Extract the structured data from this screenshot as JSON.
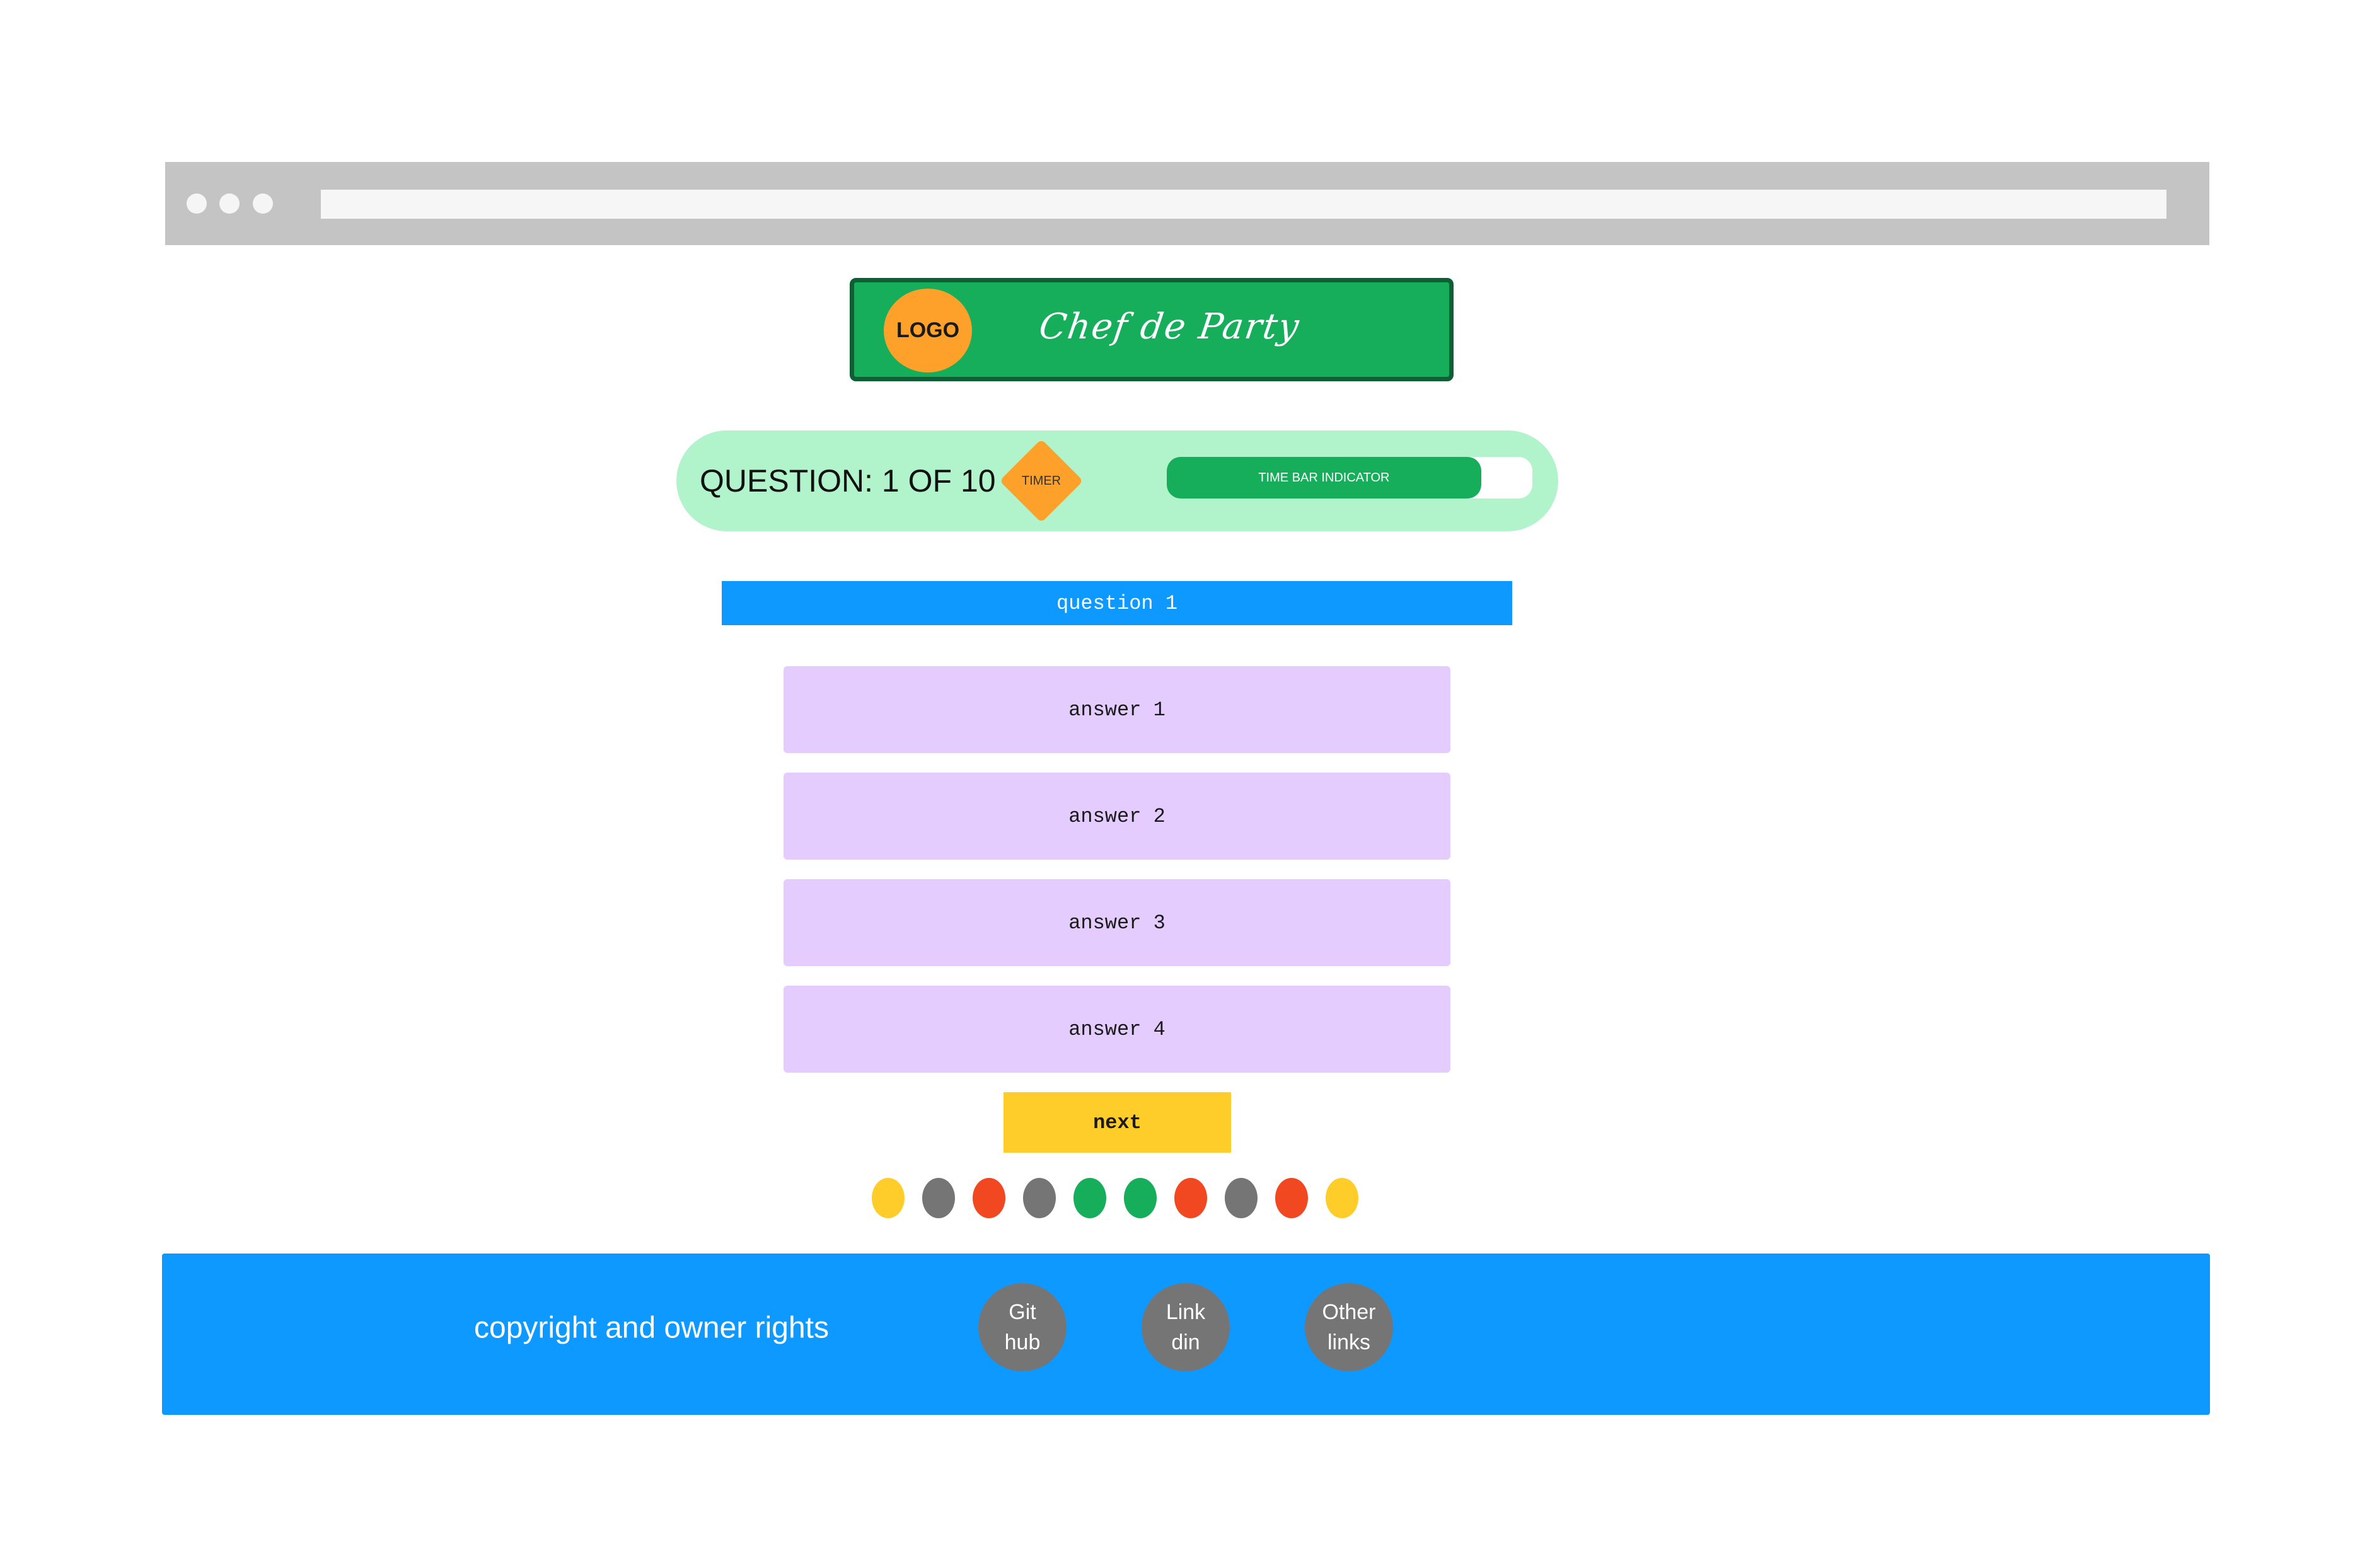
{
  "brand": {
    "logo_label": "LOGO",
    "title": "Chef de Party"
  },
  "status": {
    "question_count": "QUESTION: 1 OF 10",
    "timer_label": "TIMER",
    "time_bar_label": "TIME BAR INDICATOR",
    "time_remaining_fraction": 0.86
  },
  "question": {
    "text": "question 1"
  },
  "answers": [
    {
      "label": "answer 1"
    },
    {
      "label": "answer 2"
    },
    {
      "label": "answer 3"
    },
    {
      "label": "answer 4"
    }
  ],
  "next_label": "next",
  "progress": [
    {
      "color": "#ffcd29"
    },
    {
      "color": "#757575"
    },
    {
      "color": "#f24822"
    },
    {
      "color": "#757575"
    },
    {
      "color": "#16ae5b"
    },
    {
      "color": "#16ae5b"
    },
    {
      "color": "#f24822"
    },
    {
      "color": "#757575"
    },
    {
      "color": "#f24822"
    },
    {
      "color": "#ffcd29"
    }
  ],
  "footer": {
    "copyright": "copyright and owner rights",
    "links": [
      {
        "line1": "Git",
        "line2": "hub"
      },
      {
        "line1": "Link",
        "line2": "din"
      },
      {
        "line1": "Other",
        "line2": "links"
      }
    ]
  },
  "colors": {
    "accent_blue": "#0d99ff",
    "brand_green": "#16ae5b",
    "status_bg": "#b1f4cb",
    "answer_bg": "#e4ccff",
    "next_bg": "#ffcd29",
    "logo_orange": "#fda12a"
  }
}
